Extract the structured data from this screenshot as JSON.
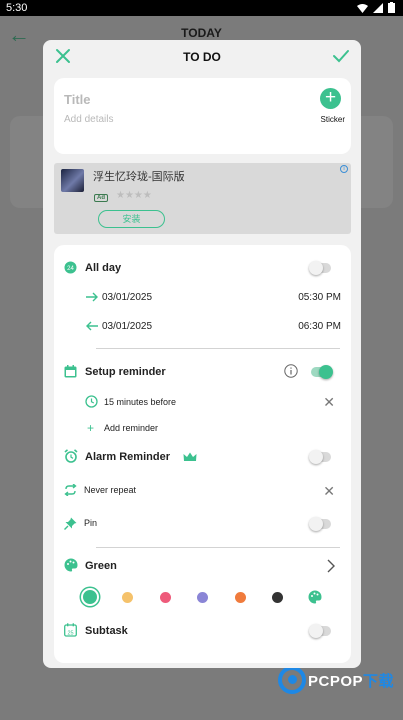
{
  "status_bar": {
    "time": "5:30"
  },
  "background": {
    "title": "TODAY"
  },
  "dialog": {
    "title": "TO DO",
    "title_placeholder": "Title",
    "details_placeholder": "Add details",
    "sticker_label": "Sticker"
  },
  "ad": {
    "app_name": "浮生忆玲珑-国际版",
    "badge": "Ad",
    "install_label": "安装",
    "rating_stars": 0
  },
  "settings": {
    "all_day_label": "All day",
    "all_day_on": false,
    "start_date": "03/01/2025",
    "start_time": "05:30 PM",
    "end_date": "03/01/2025",
    "end_time": "06:30 PM",
    "reminder_label": "Setup reminder",
    "reminder_on": true,
    "reminder_item": "15 minutes before",
    "add_reminder_label": "Add reminder",
    "alarm_label": "Alarm Reminder",
    "alarm_on": false,
    "repeat_label": "Never repeat",
    "pin_label": "Pin",
    "pin_on": false,
    "color_label": "Green",
    "color_options": [
      "#3cc18f",
      "#f5c26b",
      "#ee5a7a",
      "#8a85d6",
      "#f07b3c",
      "#333333"
    ],
    "selected_color_index": 0,
    "subtask_label": "Subtask",
    "subtask_on": false
  },
  "colors": {
    "accent": "#3cc18f",
    "crown": "#3cc18f"
  }
}
